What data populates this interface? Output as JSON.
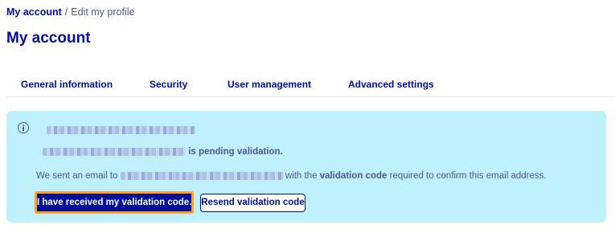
{
  "breadcrumb": {
    "parent_label": "My account",
    "separator": "/",
    "current_label": "Edit my profile"
  },
  "page_title": "My account",
  "tabs": [
    {
      "label": "General information"
    },
    {
      "label": "Security"
    },
    {
      "label": "User management"
    },
    {
      "label": "Advanced settings"
    }
  ],
  "alert": {
    "icon": "info-icon",
    "pending_suffix": "is pending validation.",
    "sent_prefix": "We sent an email to",
    "sent_middle": "with the",
    "validation_code_label": "validation code",
    "sent_suffix": "required to confirm this email address.",
    "primary_button_label": "I have received my validation code.",
    "secondary_button_label": "Resend validation code"
  },
  "colors": {
    "brand": "#000e9c",
    "alert_background": "#bef1fb",
    "focus_ring": "#ffa21e",
    "muted_text": "#4d5693"
  }
}
